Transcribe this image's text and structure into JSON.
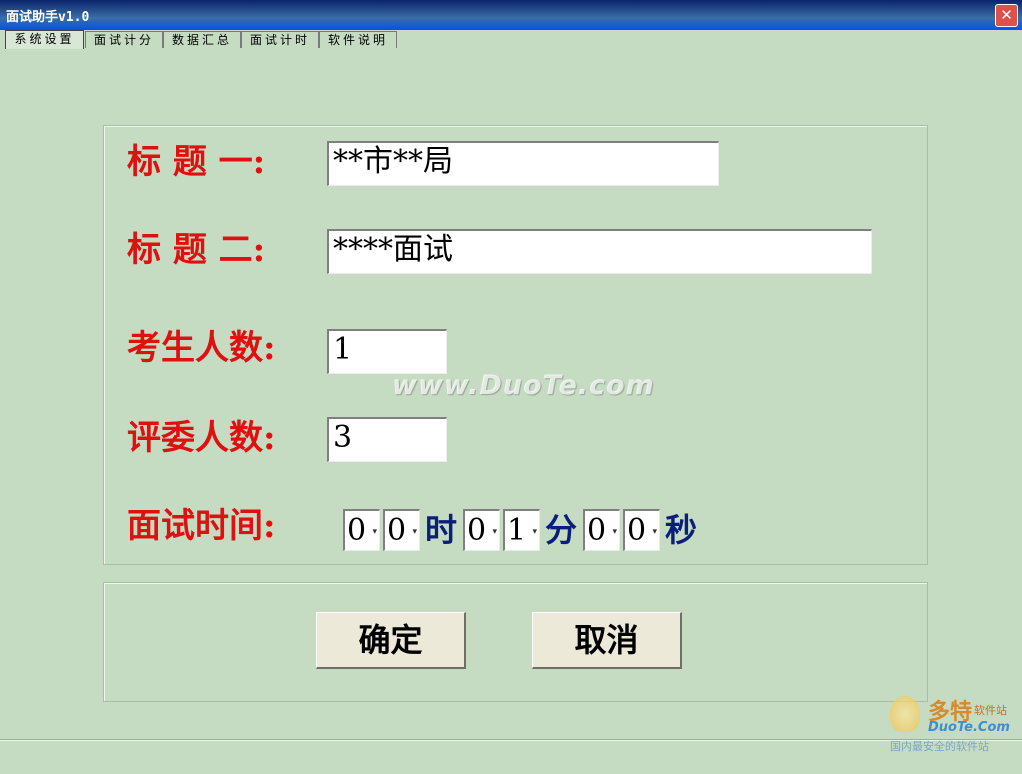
{
  "window": {
    "title": "面试助手v1.0",
    "close_label": "✕"
  },
  "tabs": [
    "系统设置",
    "面试计分",
    "数据汇总",
    "面试计时",
    "软件说明"
  ],
  "form": {
    "title1_label": "标 题 一:",
    "title1_value": "**市**局",
    "title2_label": "标 题 二:",
    "title2_value": "****面试",
    "examinees_label": "考生人数:",
    "examinees_value": "1",
    "judges_label": "评委人数:",
    "judges_value": "3",
    "time_label": "面试时间:",
    "time": {
      "h1": "0",
      "h2": "0",
      "hour_unit": "时",
      "m1": "0",
      "m2": "1",
      "minute_unit": "分",
      "s1": "0",
      "s2": "0",
      "second_unit": "秒"
    }
  },
  "buttons": {
    "ok": "确定",
    "cancel": "取消"
  },
  "watermark": "www.DuoTe.com",
  "logo": {
    "name": "多特",
    "tag": "软件站",
    "brand": "DuoTe.Com",
    "subtitle": "国内最安全的软件站"
  }
}
